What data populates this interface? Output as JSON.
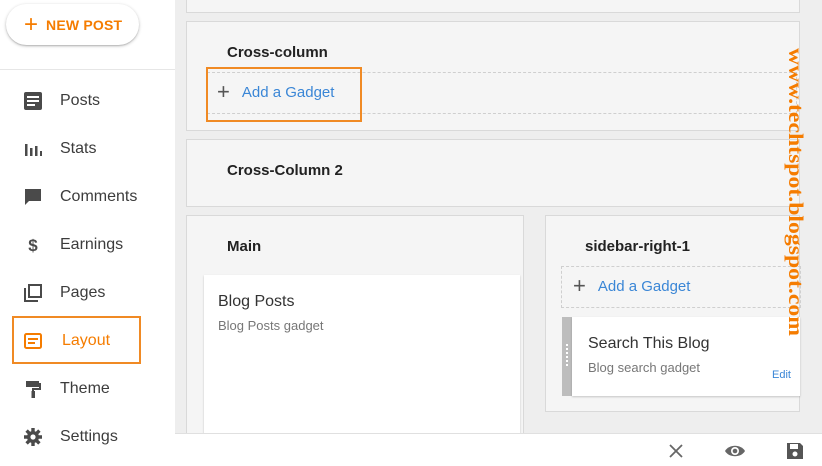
{
  "new_post": {
    "label": "NEW POST"
  },
  "nav": {
    "items": [
      {
        "label": "Posts",
        "icon": "posts-icon"
      },
      {
        "label": "Stats",
        "icon": "stats-icon"
      },
      {
        "label": "Comments",
        "icon": "comments-icon"
      },
      {
        "label": "Earnings",
        "icon": "earnings-icon"
      },
      {
        "label": "Pages",
        "icon": "pages-icon"
      },
      {
        "label": "Layout",
        "icon": "layout-icon",
        "active": true
      },
      {
        "label": "Theme",
        "icon": "theme-icon"
      },
      {
        "label": "Settings",
        "icon": "settings-icon"
      }
    ]
  },
  "layout": {
    "cross_column": {
      "title": "Cross-column",
      "add_gadget": "Add a Gadget"
    },
    "cross_column_2": {
      "title": "Cross-Column 2"
    },
    "main": {
      "title": "Main",
      "gadget": {
        "title": "Blog Posts",
        "subtitle": "Blog Posts gadget"
      }
    },
    "sidebar": {
      "title": "sidebar-right-1",
      "add_gadget": "Add a Gadget",
      "gadget": {
        "title": "Search This Blog",
        "subtitle": "Blog search gadget",
        "edit": "Edit"
      }
    }
  },
  "watermark": "www.techtspot.blogspot.com",
  "toolbar": {
    "icons": [
      "close-icon",
      "preview-icon",
      "save-icon"
    ]
  },
  "colors": {
    "accent": "#f57c00",
    "link": "#3a86d6",
    "highlight": "#f08a24"
  }
}
